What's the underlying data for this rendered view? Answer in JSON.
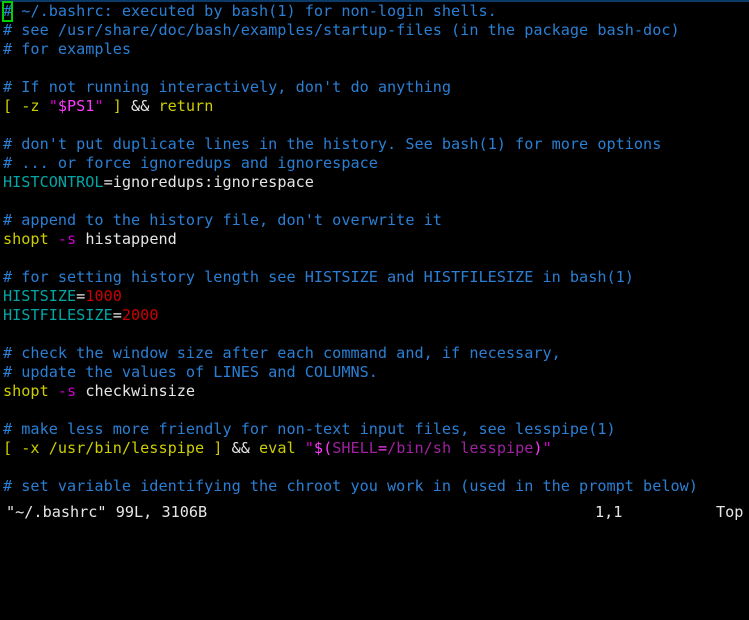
{
  "editor": {
    "name": "vim",
    "filename": "~/.bashrc",
    "cursor": {
      "char": "#",
      "color": "#00d000"
    }
  },
  "colors": {
    "background": "#000000",
    "comment": "#2a7fd4",
    "variable": "#00a6a6",
    "number": "#cc0000",
    "keyword": "#cdcd00",
    "flag": "#cc00cc",
    "plain": "#e6e6e6",
    "string": "#cc00cc",
    "dollar": "#ff39ff",
    "substitution": "#a020a0",
    "cursor": "#00d000",
    "top_rule": "#0b3a66"
  },
  "buffer": {
    "lines": [
      {
        "id": 1,
        "tokens": [
          {
            "t": "#",
            "c": "cmt",
            "cursor": true
          },
          {
            "t": " ~/.bashrc: executed by bash(1) for non-login shells.",
            "c": "cmt"
          }
        ]
      },
      {
        "id": 2,
        "tokens": [
          {
            "t": "# see /usr/share/doc/bash/examples/startup-files (in the package bash-doc)",
            "c": "cmt"
          }
        ]
      },
      {
        "id": 3,
        "tokens": [
          {
            "t": "# for examples",
            "c": "cmt"
          }
        ]
      },
      {
        "id": 4,
        "tokens": [
          {
            "t": "",
            "c": "plain"
          }
        ]
      },
      {
        "id": 5,
        "tokens": [
          {
            "t": "# If not running interactively, don't do anything",
            "c": "cmt"
          }
        ]
      },
      {
        "id": 6,
        "tokens": [
          {
            "t": "[ -z ",
            "c": "kw"
          },
          {
            "t": "\"",
            "c": "str"
          },
          {
            "t": "$PS1",
            "c": "dollar"
          },
          {
            "t": "\"",
            "c": "str"
          },
          {
            "t": " ] ",
            "c": "kw"
          },
          {
            "t": "&&",
            "c": "op"
          },
          {
            "t": " return",
            "c": "kw"
          }
        ]
      },
      {
        "id": 7,
        "tokens": [
          {
            "t": "",
            "c": "plain"
          }
        ]
      },
      {
        "id": 8,
        "tokens": [
          {
            "t": "# don't put duplicate lines in the history. See bash(1) for more options",
            "c": "cmt"
          }
        ]
      },
      {
        "id": 9,
        "tokens": [
          {
            "t": "# ... or force ignoredups and ignorespace",
            "c": "cmt"
          }
        ]
      },
      {
        "id": 10,
        "tokens": [
          {
            "t": "HISTCONTROL",
            "c": "var"
          },
          {
            "t": "=ignoredups:ignorespace",
            "c": "plain"
          }
        ]
      },
      {
        "id": 11,
        "tokens": [
          {
            "t": "",
            "c": "plain"
          }
        ]
      },
      {
        "id": 12,
        "tokens": [
          {
            "t": "# append to the history file, don't overwrite it",
            "c": "cmt"
          }
        ]
      },
      {
        "id": 13,
        "tokens": [
          {
            "t": "shopt",
            "c": "kw"
          },
          {
            "t": " ",
            "c": "plain"
          },
          {
            "t": "-s",
            "c": "flag"
          },
          {
            "t": " histappend",
            "c": "plain"
          }
        ]
      },
      {
        "id": 14,
        "tokens": [
          {
            "t": "",
            "c": "plain"
          }
        ]
      },
      {
        "id": 15,
        "tokens": [
          {
            "t": "# for setting history length see HISTSIZE and HISTFILESIZE in bash(1)",
            "c": "cmt"
          }
        ]
      },
      {
        "id": 16,
        "tokens": [
          {
            "t": "HISTSIZE",
            "c": "var"
          },
          {
            "t": "=",
            "c": "plain"
          },
          {
            "t": "1000",
            "c": "num"
          }
        ]
      },
      {
        "id": 17,
        "tokens": [
          {
            "t": "HISTFILESIZE",
            "c": "var"
          },
          {
            "t": "=",
            "c": "plain"
          },
          {
            "t": "2000",
            "c": "num"
          }
        ]
      },
      {
        "id": 18,
        "tokens": [
          {
            "t": "",
            "c": "plain"
          }
        ]
      },
      {
        "id": 19,
        "tokens": [
          {
            "t": "# check the window size after each command and, if necessary,",
            "c": "cmt"
          }
        ]
      },
      {
        "id": 20,
        "tokens": [
          {
            "t": "# update the values of LINES and COLUMNS.",
            "c": "cmt"
          }
        ]
      },
      {
        "id": 21,
        "tokens": [
          {
            "t": "shopt",
            "c": "kw"
          },
          {
            "t": " ",
            "c": "plain"
          },
          {
            "t": "-s",
            "c": "flag"
          },
          {
            "t": " checkwinsize",
            "c": "plain"
          }
        ]
      },
      {
        "id": 22,
        "tokens": [
          {
            "t": "",
            "c": "plain"
          }
        ]
      },
      {
        "id": 23,
        "tokens": [
          {
            "t": "# make less more friendly for non-text input files, see lesspipe(1)",
            "c": "cmt"
          }
        ]
      },
      {
        "id": 24,
        "tokens": [
          {
            "t": "[ -x /usr/bin/lesspipe ] ",
            "c": "kw"
          },
          {
            "t": "&&",
            "c": "op"
          },
          {
            "t": " eval ",
            "c": "kw"
          },
          {
            "t": "\"",
            "c": "str"
          },
          {
            "t": "$(",
            "c": "dollar"
          },
          {
            "t": "SHELL",
            "c": "subst"
          },
          {
            "t": "=",
            "c": "dollar"
          },
          {
            "t": "/bin/sh lesspipe",
            "c": "subst"
          },
          {
            "t": ")",
            "c": "dollar"
          },
          {
            "t": "\"",
            "c": "str"
          }
        ]
      },
      {
        "id": 25,
        "tokens": [
          {
            "t": "",
            "c": "plain"
          }
        ]
      },
      {
        "id": 26,
        "tokens": [
          {
            "t": "# set variable identifying the chroot you work in (used in the prompt below)",
            "c": "cmt"
          }
        ]
      }
    ]
  },
  "status_line": {
    "file_info": "\"~/.bashrc\" 99L, 3106B",
    "filename": "~/.bashrc",
    "line_count": "99L",
    "byte_count": "3106B",
    "cursor_position": "1,1",
    "scroll_position": "Top"
  }
}
